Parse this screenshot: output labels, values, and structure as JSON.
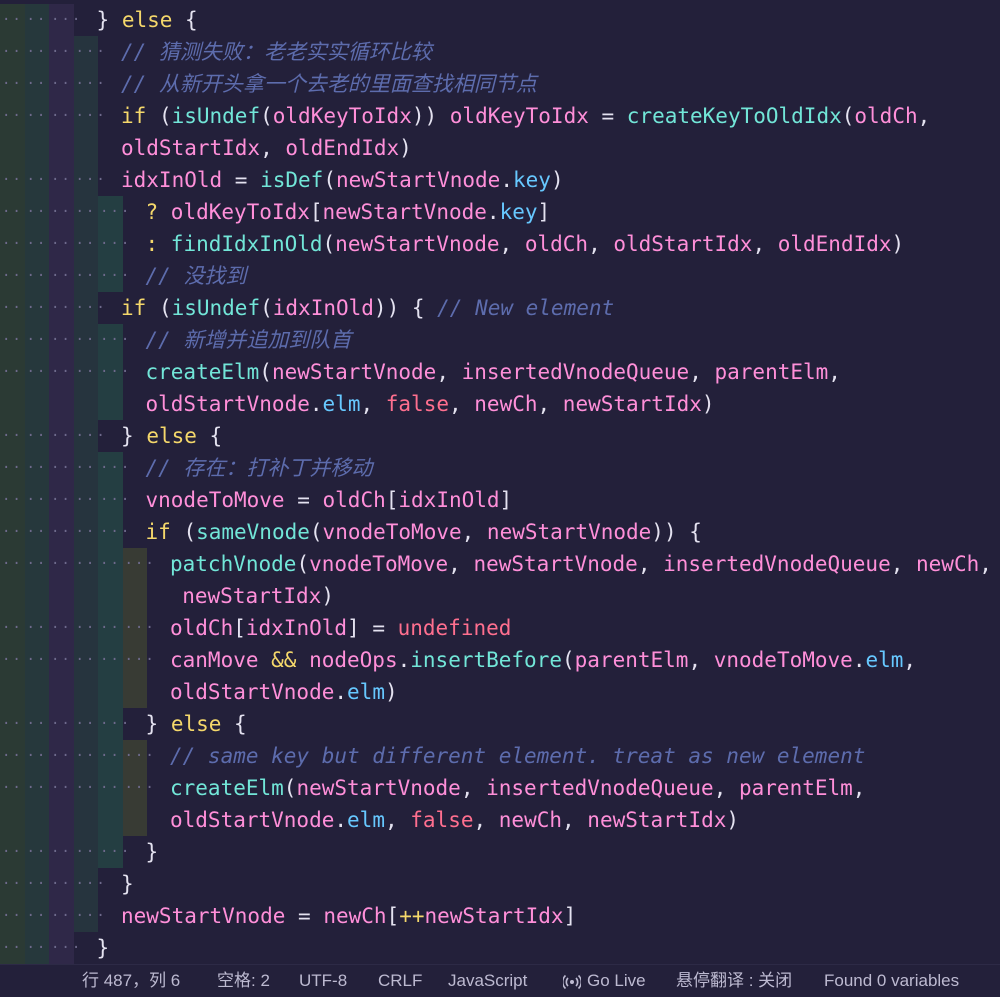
{
  "editor": {
    "lines": [
      {
        "indent": 3,
        "wrap": false,
        "tokens": [
          [
            "}",
            "punc"
          ],
          [
            " ",
            "plain"
          ],
          [
            "else",
            "kw"
          ],
          [
            " {",
            "punc"
          ]
        ]
      },
      {
        "indent": 4,
        "wrap": false,
        "tokens": [
          [
            "// 猜测失败：老老实实循环比较",
            "com"
          ]
        ]
      },
      {
        "indent": 4,
        "wrap": false,
        "tokens": [
          [
            "// 从新开头拿一个去老的里面查找相同节点",
            "com"
          ]
        ]
      },
      {
        "indent": 4,
        "wrap": false,
        "tokens": [
          [
            "if",
            "kw"
          ],
          [
            " (",
            "punc"
          ],
          [
            "isUndef",
            "fn"
          ],
          [
            "(",
            "punc"
          ],
          [
            "oldKeyToIdx",
            "var"
          ],
          [
            ")) ",
            "punc"
          ],
          [
            "oldKeyToIdx",
            "var"
          ],
          [
            " = ",
            "op"
          ],
          [
            "createKeyToOldIdx",
            "fn"
          ],
          [
            "(",
            "punc"
          ],
          [
            "oldCh",
            "var"
          ],
          [
            ",",
            "punc"
          ]
        ]
      },
      {
        "indent": 4,
        "wrap": true,
        "tokens": [
          [
            "oldStartIdx",
            "var"
          ],
          [
            ", ",
            "punc"
          ],
          [
            "oldEndIdx",
            "var"
          ],
          [
            ")",
            "punc"
          ]
        ]
      },
      {
        "indent": 4,
        "wrap": false,
        "tokens": [
          [
            "idxInOld",
            "var"
          ],
          [
            " = ",
            "op"
          ],
          [
            "isDef",
            "fn"
          ],
          [
            "(",
            "punc"
          ],
          [
            "newStartVnode",
            "var"
          ],
          [
            ".",
            "punc"
          ],
          [
            "key",
            "prop"
          ],
          [
            ")",
            "punc"
          ]
        ]
      },
      {
        "indent": 5,
        "wrap": false,
        "tokens": [
          [
            "? ",
            "kw"
          ],
          [
            "oldKeyToIdx",
            "var"
          ],
          [
            "[",
            "punc"
          ],
          [
            "newStartVnode",
            "var"
          ],
          [
            ".",
            "punc"
          ],
          [
            "key",
            "prop"
          ],
          [
            "]",
            "punc"
          ]
        ]
      },
      {
        "indent": 5,
        "wrap": false,
        "tokens": [
          [
            ": ",
            "kw"
          ],
          [
            "findIdxInOld",
            "fn"
          ],
          [
            "(",
            "punc"
          ],
          [
            "newStartVnode",
            "var"
          ],
          [
            ", ",
            "punc"
          ],
          [
            "oldCh",
            "var"
          ],
          [
            ", ",
            "punc"
          ],
          [
            "oldStartIdx",
            "var"
          ],
          [
            ", ",
            "punc"
          ],
          [
            "oldEndIdx",
            "var"
          ],
          [
            ")",
            "punc"
          ]
        ]
      },
      {
        "indent": 5,
        "wrap": false,
        "tokens": [
          [
            "// 没找到",
            "com"
          ]
        ]
      },
      {
        "indent": 4,
        "wrap": false,
        "tokens": [
          [
            "if",
            "kw"
          ],
          [
            " (",
            "punc"
          ],
          [
            "isUndef",
            "fn"
          ],
          [
            "(",
            "punc"
          ],
          [
            "idxInOld",
            "var"
          ],
          [
            ")) { ",
            "punc"
          ],
          [
            "// New element",
            "com"
          ]
        ]
      },
      {
        "indent": 5,
        "wrap": false,
        "tokens": [
          [
            "// 新增并追加到队首",
            "com"
          ]
        ]
      },
      {
        "indent": 5,
        "wrap": false,
        "tokens": [
          [
            "createElm",
            "fn"
          ],
          [
            "(",
            "punc"
          ],
          [
            "newStartVnode",
            "var"
          ],
          [
            ", ",
            "punc"
          ],
          [
            "insertedVnodeQueue",
            "var"
          ],
          [
            ", ",
            "punc"
          ],
          [
            "parentElm",
            "var"
          ],
          [
            ",",
            "punc"
          ]
        ]
      },
      {
        "indent": 5,
        "wrap": true,
        "tokens": [
          [
            "oldStartVnode",
            "var"
          ],
          [
            ".",
            "punc"
          ],
          [
            "elm",
            "prop"
          ],
          [
            ", ",
            "punc"
          ],
          [
            "false",
            "bool"
          ],
          [
            ", ",
            "punc"
          ],
          [
            "newCh",
            "var"
          ],
          [
            ", ",
            "punc"
          ],
          [
            "newStartIdx",
            "var"
          ],
          [
            ")",
            "punc"
          ]
        ]
      },
      {
        "indent": 4,
        "wrap": false,
        "tokens": [
          [
            "}",
            "punc"
          ],
          [
            " ",
            "plain"
          ],
          [
            "else",
            "kw"
          ],
          [
            " {",
            "punc"
          ]
        ]
      },
      {
        "indent": 5,
        "wrap": false,
        "tokens": [
          [
            "// 存在：打补丁并移动",
            "com"
          ]
        ]
      },
      {
        "indent": 5,
        "wrap": false,
        "tokens": [
          [
            "vnodeToMove",
            "var"
          ],
          [
            " = ",
            "op"
          ],
          [
            "oldCh",
            "var"
          ],
          [
            "[",
            "punc"
          ],
          [
            "idxInOld",
            "var"
          ],
          [
            "]",
            "punc"
          ]
        ]
      },
      {
        "indent": 5,
        "wrap": false,
        "tokens": [
          [
            "if",
            "kw"
          ],
          [
            " (",
            "punc"
          ],
          [
            "sameVnode",
            "fn"
          ],
          [
            "(",
            "punc"
          ],
          [
            "vnodeToMove",
            "var"
          ],
          [
            ", ",
            "punc"
          ],
          [
            "newStartVnode",
            "var"
          ],
          [
            ")) {",
            "punc"
          ]
        ]
      },
      {
        "indent": 6,
        "wrap": false,
        "tokens": [
          [
            "patchVnode",
            "fn"
          ],
          [
            "(",
            "punc"
          ],
          [
            "vnodeToMove",
            "var"
          ],
          [
            ", ",
            "punc"
          ],
          [
            "newStartVnode",
            "var"
          ],
          [
            ", ",
            "punc"
          ],
          [
            "insertedVnodeQueue",
            "var"
          ],
          [
            ", ",
            "punc"
          ],
          [
            "newCh",
            "var"
          ],
          [
            ",",
            "punc"
          ]
        ]
      },
      {
        "indent": 6,
        "wrap": true,
        "extra": 0.5,
        "tokens": [
          [
            "newStartIdx",
            "var"
          ],
          [
            ")",
            "punc"
          ]
        ]
      },
      {
        "indent": 6,
        "wrap": false,
        "tokens": [
          [
            "oldCh",
            "var"
          ],
          [
            "[",
            "punc"
          ],
          [
            "idxInOld",
            "var"
          ],
          [
            "] = ",
            "punc"
          ],
          [
            "undefined",
            "bool"
          ]
        ]
      },
      {
        "indent": 6,
        "wrap": false,
        "tokens": [
          [
            "canMove",
            "var"
          ],
          [
            " && ",
            "kw"
          ],
          [
            "nodeOps",
            "var"
          ],
          [
            ".",
            "punc"
          ],
          [
            "insertBefore",
            "fn"
          ],
          [
            "(",
            "punc"
          ],
          [
            "parentElm",
            "var"
          ],
          [
            ", ",
            "punc"
          ],
          [
            "vnodeToMove",
            "var"
          ],
          [
            ".",
            "punc"
          ],
          [
            "elm",
            "prop"
          ],
          [
            ",",
            "punc"
          ]
        ]
      },
      {
        "indent": 6,
        "wrap": true,
        "tokens": [
          [
            "oldStartVnode",
            "var"
          ],
          [
            ".",
            "punc"
          ],
          [
            "elm",
            "prop"
          ],
          [
            ")",
            "punc"
          ]
        ]
      },
      {
        "indent": 5,
        "wrap": false,
        "tokens": [
          [
            "}",
            "punc"
          ],
          [
            " ",
            "plain"
          ],
          [
            "else",
            "kw"
          ],
          [
            " {",
            "punc"
          ]
        ]
      },
      {
        "indent": 6,
        "wrap": false,
        "tokens": [
          [
            "// same key but different element. treat as new element",
            "com"
          ]
        ]
      },
      {
        "indent": 6,
        "wrap": false,
        "tokens": [
          [
            "createElm",
            "fn"
          ],
          [
            "(",
            "punc"
          ],
          [
            "newStartVnode",
            "var"
          ],
          [
            ", ",
            "punc"
          ],
          [
            "insertedVnodeQueue",
            "var"
          ],
          [
            ", ",
            "punc"
          ],
          [
            "parentElm",
            "var"
          ],
          [
            ",",
            "punc"
          ]
        ]
      },
      {
        "indent": 6,
        "wrap": true,
        "tokens": [
          [
            "oldStartVnode",
            "var"
          ],
          [
            ".",
            "punc"
          ],
          [
            "elm",
            "prop"
          ],
          [
            ", ",
            "punc"
          ],
          [
            "false",
            "bool"
          ],
          [
            ", ",
            "punc"
          ],
          [
            "newCh",
            "var"
          ],
          [
            ", ",
            "punc"
          ],
          [
            "newStartIdx",
            "var"
          ],
          [
            ")",
            "punc"
          ]
        ]
      },
      {
        "indent": 5,
        "wrap": false,
        "tokens": [
          [
            "}",
            "punc"
          ]
        ]
      },
      {
        "indent": 4,
        "wrap": false,
        "tokens": [
          [
            "}",
            "punc"
          ]
        ]
      },
      {
        "indent": 4,
        "wrap": false,
        "tokens": [
          [
            "newStartVnode",
            "var"
          ],
          [
            " = ",
            "op"
          ],
          [
            "newCh",
            "var"
          ],
          [
            "[",
            "punc"
          ],
          [
            "++",
            "kw"
          ],
          [
            "newStartIdx",
            "var"
          ],
          [
            "]",
            "punc"
          ]
        ]
      },
      {
        "indent": 3,
        "wrap": false,
        "tokens": [
          [
            "}",
            "punc"
          ]
        ]
      }
    ]
  },
  "statusbar": {
    "position": "行 487，列 6",
    "spaces": "空格: 2",
    "encoding": "UTF-8",
    "eol": "CRLF",
    "language": "JavaScript",
    "go_live": "Go Live",
    "translate": "悬停翻译 : 关闭",
    "found": "Found 0 variables"
  },
  "colors": {
    "background": "#23203a",
    "keyword": "#f5d86b",
    "function": "#72e6d8",
    "variable": "#ff8fd9",
    "property": "#67c8ff",
    "boolean": "#ff6f8f",
    "comment": "#5d6cad",
    "indent_guides": [
      "#2b3a34",
      "#26383c",
      "#2f2848",
      "#26343e",
      "#243e42",
      "#383b34",
      "#38343a"
    ]
  }
}
